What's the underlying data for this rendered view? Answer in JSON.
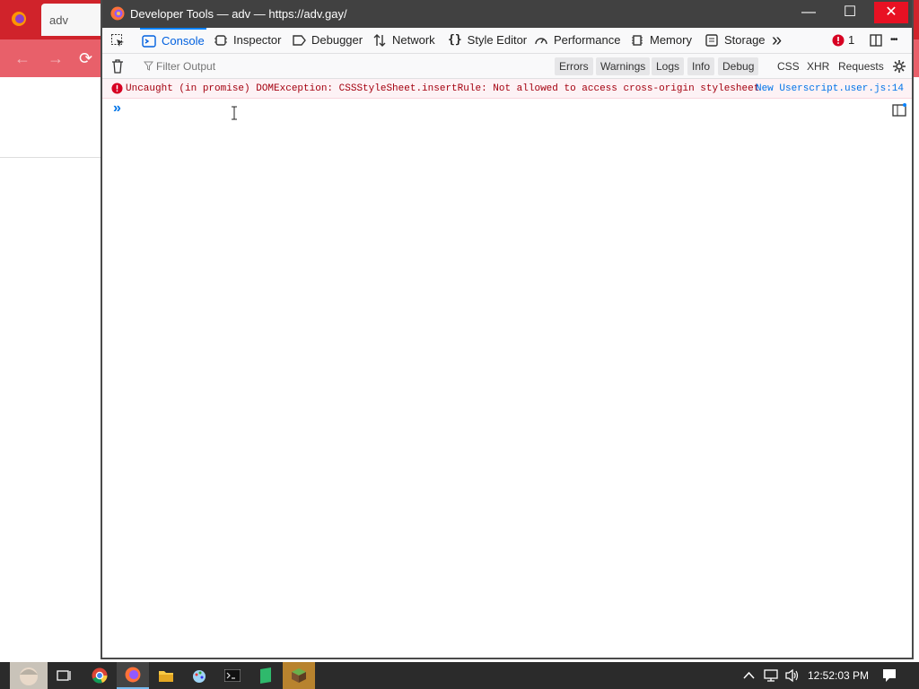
{
  "background_browser": {
    "tab_title": "adv",
    "nav": {
      "back": "←",
      "forward": "→",
      "reload": "⟳"
    }
  },
  "window": {
    "title": "Developer Tools — adv — https://adv.gay/",
    "minimize": "—",
    "maximize": "☐",
    "close": "✕"
  },
  "toolbar": {
    "tabs": [
      "Console",
      "Inspector",
      "Debugger",
      "Network",
      "Style Editor",
      "Performance",
      "Memory",
      "Storage"
    ],
    "more": "»",
    "error_count": "1",
    "menu": "•••"
  },
  "filter": {
    "placeholder": "Filter Output",
    "levels": [
      "Errors",
      "Warnings",
      "Logs",
      "Info",
      "Debug"
    ],
    "types": [
      "CSS",
      "XHR",
      "Requests"
    ]
  },
  "console": {
    "error_message": "Uncaught (in promise) DOMException: CSSStyleSheet.insertRule: Not allowed to access cross-origin stylesheet",
    "error_source": "New Userscript.user.js:14",
    "prompt": "»"
  },
  "taskbar": {
    "time": "12:52:03 PM"
  },
  "colors": {
    "accent": "#0a84ff",
    "error": "#a4000f",
    "firefox_red": "#d0232b",
    "titlebar": "#414141"
  }
}
